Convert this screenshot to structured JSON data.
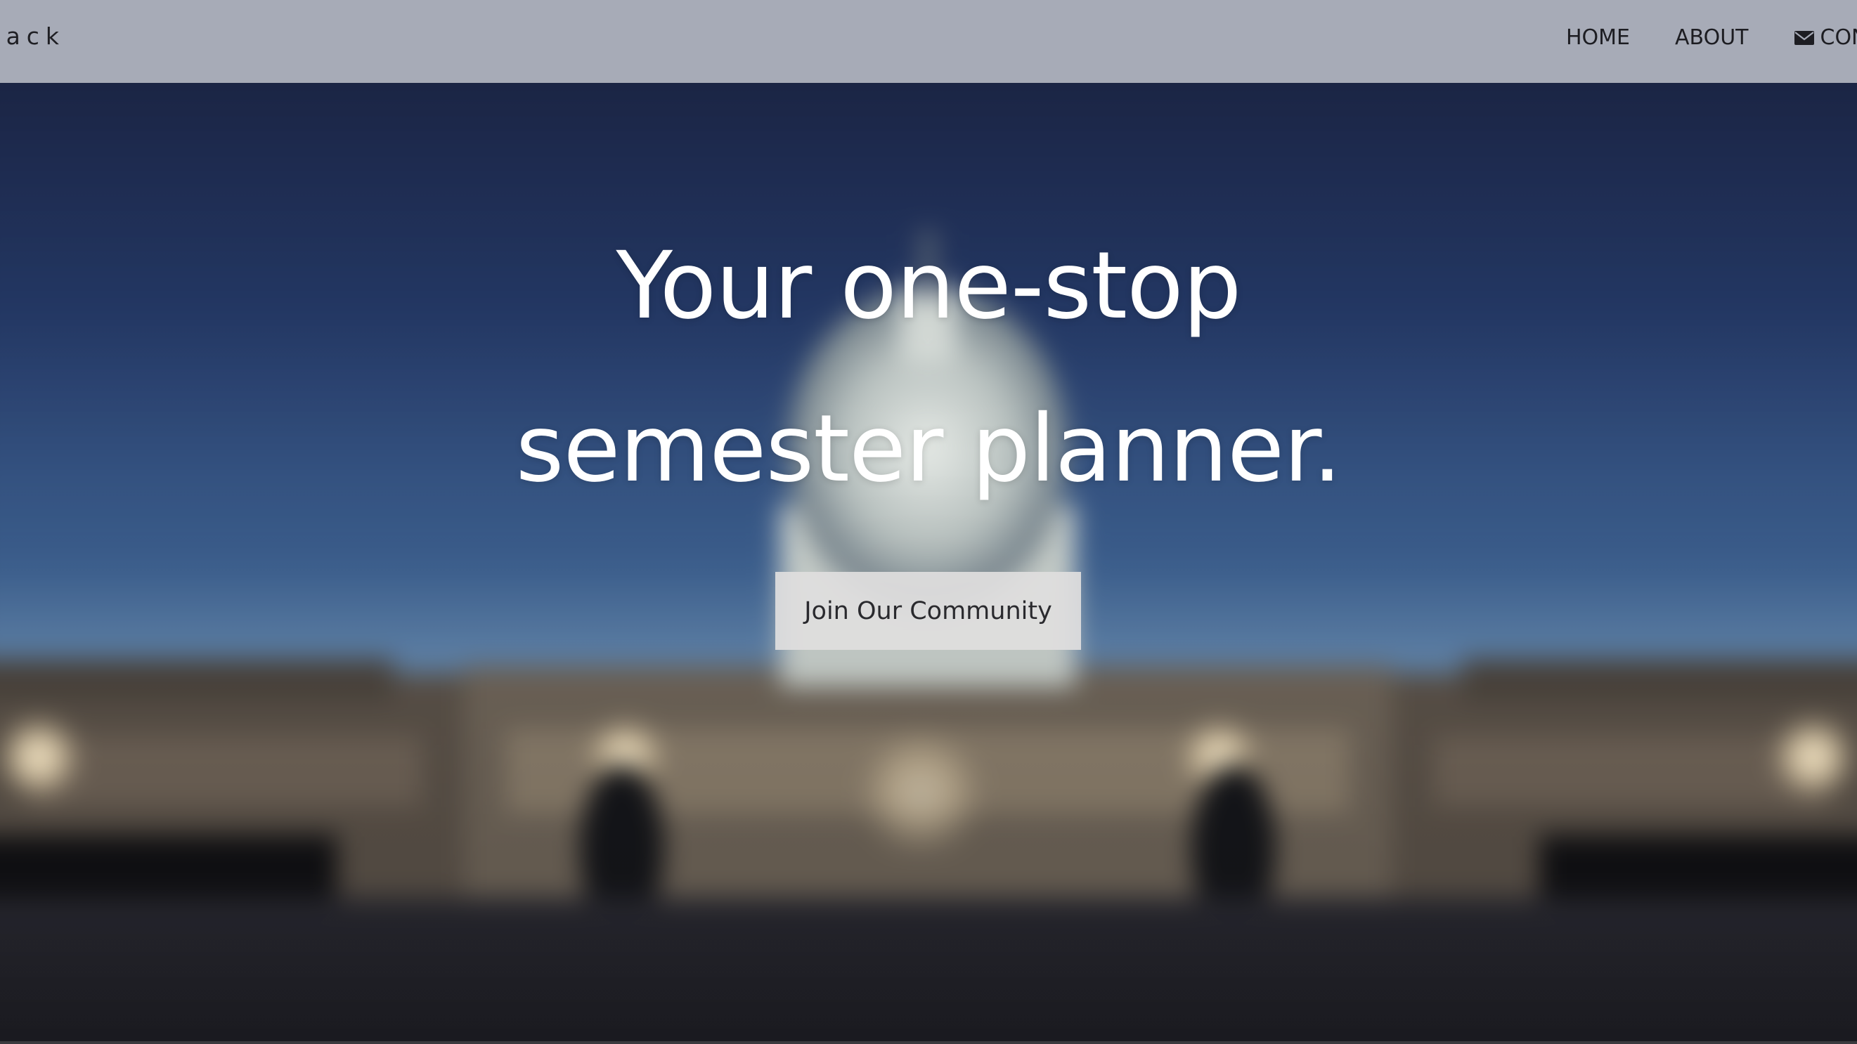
{
  "navbar": {
    "brand": "rack",
    "links": [
      {
        "label": "HOME"
      },
      {
        "label": "ABOUT"
      },
      {
        "label": "CON",
        "icon": "envelope-icon"
      }
    ]
  },
  "hero": {
    "title_line_1": "Your one-stop",
    "title_line_2": "semester planner.",
    "cta_label": "Join Our Community",
    "background_image": "blurred night view of a domed capitol building"
  },
  "colors": {
    "navbar_bg": "#a7abb7",
    "nav_text": "#1d1d22",
    "hero_text": "#ffffff",
    "cta_bg": "#e0dede",
    "cta_text": "#2a2a2e"
  }
}
